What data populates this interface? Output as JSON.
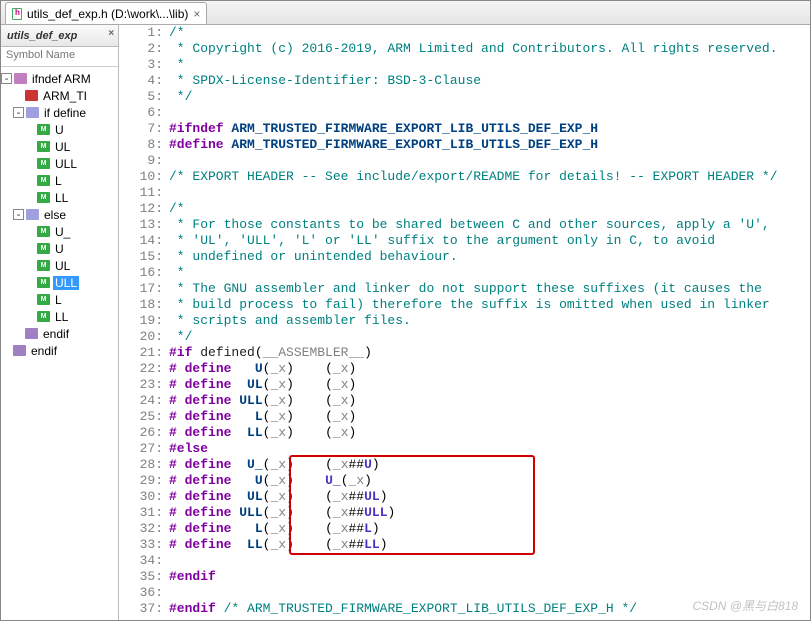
{
  "tab": {
    "title": "utils_def_exp.h (D:\\work\\...\\lib)"
  },
  "side": {
    "panel_title": "utils_def_exp",
    "header": "Symbol Name",
    "nodes": [
      {
        "indent": 0,
        "tw": "-",
        "ic": "ic-ifn",
        "label": "ifndef ARM"
      },
      {
        "indent": 1,
        "tw": "",
        "ic": "ic-red",
        "label": "ARM_TI"
      },
      {
        "indent": 1,
        "tw": "-",
        "ic": "ic-if",
        "label": "if define"
      },
      {
        "indent": 2,
        "tw": "",
        "ic": "ic-m",
        "label": "U"
      },
      {
        "indent": 2,
        "tw": "",
        "ic": "ic-m",
        "label": "UL"
      },
      {
        "indent": 2,
        "tw": "",
        "ic": "ic-m",
        "label": "ULL"
      },
      {
        "indent": 2,
        "tw": "",
        "ic": "ic-m",
        "label": "L"
      },
      {
        "indent": 2,
        "tw": "",
        "ic": "ic-m",
        "label": "LL"
      },
      {
        "indent": 1,
        "tw": "-",
        "ic": "ic-el",
        "label": "else"
      },
      {
        "indent": 2,
        "tw": "",
        "ic": "ic-m",
        "label": "U_"
      },
      {
        "indent": 2,
        "tw": "",
        "ic": "ic-m",
        "label": "U"
      },
      {
        "indent": 2,
        "tw": "",
        "ic": "ic-m",
        "label": "UL"
      },
      {
        "indent": 2,
        "tw": "",
        "ic": "ic-m",
        "label": "ULL",
        "selected": true
      },
      {
        "indent": 2,
        "tw": "",
        "ic": "ic-m",
        "label": "L"
      },
      {
        "indent": 2,
        "tw": "",
        "ic": "ic-m",
        "label": "LL"
      },
      {
        "indent": 1,
        "tw": "",
        "ic": "ic-end",
        "label": "endif"
      },
      {
        "indent": 0,
        "tw": "",
        "ic": "ic-end",
        "label": "endif"
      }
    ]
  },
  "code": {
    "lines": [
      {
        "n": 1,
        "seg": [
          {
            "c": "c-cmt",
            "t": "/*"
          }
        ]
      },
      {
        "n": 2,
        "seg": [
          {
            "c": "c-cmt",
            "t": " * Copyright (c) 2016-2019, ARM Limited and Contributors. All rights reserved."
          }
        ]
      },
      {
        "n": 3,
        "seg": [
          {
            "c": "c-cmt",
            "t": " *"
          }
        ]
      },
      {
        "n": 4,
        "seg": [
          {
            "c": "c-cmt",
            "t": " * SPDX-License-Identifier: BSD-3-Clause"
          }
        ]
      },
      {
        "n": 5,
        "seg": [
          {
            "c": "c-cmt",
            "t": " */"
          }
        ]
      },
      {
        "n": 6,
        "seg": [
          {
            "c": "",
            "t": ""
          }
        ]
      },
      {
        "n": 7,
        "seg": [
          {
            "c": "c-pp",
            "t": "#ifndef"
          },
          {
            "c": "",
            "t": " "
          },
          {
            "c": "c-mac",
            "t": "ARM_TRUSTED_FIRMWARE_EXPORT_LIB_UTILS_DEF_EXP_H"
          }
        ],
        "gut": ":"
      },
      {
        "n": 8,
        "seg": [
          {
            "c": "c-pp",
            "t": "#define"
          },
          {
            "c": "",
            "t": " "
          },
          {
            "c": "c-mac",
            "t": "ARM_TRUSTED_FIRMWARE_EXPORT_LIB_UTILS_DEF_EXP_H"
          }
        ]
      },
      {
        "n": 9,
        "seg": [
          {
            "c": "",
            "t": ""
          }
        ]
      },
      {
        "n": 10,
        "seg": [
          {
            "c": "c-cmt",
            "t": "/* EXPORT HEADER -- See include/export/README for details! -- EXPORT HEADER */"
          }
        ]
      },
      {
        "n": 11,
        "seg": [
          {
            "c": "",
            "t": ""
          }
        ]
      },
      {
        "n": 12,
        "seg": [
          {
            "c": "c-cmt",
            "t": "/*"
          }
        ]
      },
      {
        "n": 13,
        "seg": [
          {
            "c": "c-cmt",
            "t": " * For those constants to be shared between C and other sources, apply a 'U',"
          }
        ]
      },
      {
        "n": 14,
        "seg": [
          {
            "c": "c-cmt",
            "t": " * 'UL', 'ULL', 'L' or 'LL' suffix to the argument only in C, to avoid"
          }
        ]
      },
      {
        "n": 15,
        "seg": [
          {
            "c": "c-cmt",
            "t": " * undefined or unintended behaviour."
          }
        ]
      },
      {
        "n": 16,
        "seg": [
          {
            "c": "c-cmt",
            "t": " *"
          }
        ]
      },
      {
        "n": 17,
        "seg": [
          {
            "c": "c-cmt",
            "t": " * The GNU assembler and linker do not support these suffixes (it causes the"
          }
        ]
      },
      {
        "n": 18,
        "seg": [
          {
            "c": "c-cmt",
            "t": " * build process to fail) therefore the suffix is omitted when used in linker"
          }
        ]
      },
      {
        "n": 19,
        "seg": [
          {
            "c": "c-cmt",
            "t": " * scripts and assembler files."
          }
        ]
      },
      {
        "n": 20,
        "seg": [
          {
            "c": "c-cmt",
            "t": " */"
          }
        ]
      },
      {
        "n": 21,
        "seg": [
          {
            "c": "c-pp",
            "t": "#if"
          },
          {
            "c": "",
            "t": " "
          },
          {
            "c": "c-kw",
            "t": "defined"
          },
          {
            "c": "",
            "t": "("
          },
          {
            "c": "c-arg",
            "t": "__ASSEMBLER__"
          },
          {
            "c": "",
            "t": ")"
          }
        ],
        "gut": ":"
      },
      {
        "n": 22,
        "seg": [
          {
            "c": "c-pp",
            "t": "#"
          },
          {
            "c": "",
            "t": " "
          },
          {
            "c": "c-pp",
            "t": "define"
          },
          {
            "c": "",
            "t": "   "
          },
          {
            "c": "c-mac",
            "t": "U"
          },
          {
            "c": "",
            "t": "("
          },
          {
            "c": "c-arg",
            "t": "_x"
          },
          {
            "c": "",
            "t": ")    ("
          },
          {
            "c": "c-arg",
            "t": "_x"
          },
          {
            "c": "",
            "t": ")"
          }
        ]
      },
      {
        "n": 23,
        "seg": [
          {
            "c": "c-pp",
            "t": "#"
          },
          {
            "c": "",
            "t": " "
          },
          {
            "c": "c-pp",
            "t": "define"
          },
          {
            "c": "",
            "t": "  "
          },
          {
            "c": "c-mac",
            "t": "UL"
          },
          {
            "c": "",
            "t": "("
          },
          {
            "c": "c-arg",
            "t": "_x"
          },
          {
            "c": "",
            "t": ")    ("
          },
          {
            "c": "c-arg",
            "t": "_x"
          },
          {
            "c": "",
            "t": ")"
          }
        ]
      },
      {
        "n": 24,
        "seg": [
          {
            "c": "c-pp",
            "t": "#"
          },
          {
            "c": "",
            "t": " "
          },
          {
            "c": "c-pp",
            "t": "define"
          },
          {
            "c": "",
            "t": " "
          },
          {
            "c": "c-mac",
            "t": "ULL"
          },
          {
            "c": "",
            "t": "("
          },
          {
            "c": "c-arg",
            "t": "_x"
          },
          {
            "c": "",
            "t": ")    ("
          },
          {
            "c": "c-arg",
            "t": "_x"
          },
          {
            "c": "",
            "t": ")"
          }
        ]
      },
      {
        "n": 25,
        "seg": [
          {
            "c": "c-pp",
            "t": "#"
          },
          {
            "c": "",
            "t": " "
          },
          {
            "c": "c-pp",
            "t": "define"
          },
          {
            "c": "",
            "t": "   "
          },
          {
            "c": "c-mac",
            "t": "L"
          },
          {
            "c": "",
            "t": "("
          },
          {
            "c": "c-arg",
            "t": "_x"
          },
          {
            "c": "",
            "t": ")    ("
          },
          {
            "c": "c-arg",
            "t": "_x"
          },
          {
            "c": "",
            "t": ")"
          }
        ]
      },
      {
        "n": 26,
        "seg": [
          {
            "c": "c-pp",
            "t": "#"
          },
          {
            "c": "",
            "t": " "
          },
          {
            "c": "c-pp",
            "t": "define"
          },
          {
            "c": "",
            "t": "  "
          },
          {
            "c": "c-mac",
            "t": "LL"
          },
          {
            "c": "",
            "t": "("
          },
          {
            "c": "c-arg",
            "t": "_x"
          },
          {
            "c": "",
            "t": ")    ("
          },
          {
            "c": "c-arg",
            "t": "_x"
          },
          {
            "c": "",
            "t": ")"
          }
        ]
      },
      {
        "n": 27,
        "seg": [
          {
            "c": "c-pp",
            "t": "#else"
          }
        ],
        "gut": ":"
      },
      {
        "n": 28,
        "seg": [
          {
            "c": "c-pp",
            "t": "#"
          },
          {
            "c": "",
            "t": " "
          },
          {
            "c": "c-pp",
            "t": "define"
          },
          {
            "c": "",
            "t": "  "
          },
          {
            "c": "c-mac",
            "t": "U_"
          },
          {
            "c": "",
            "t": "("
          },
          {
            "c": "c-arg",
            "t": "_x"
          },
          {
            "c": "",
            "t": ")    ("
          },
          {
            "c": "c-arg",
            "t": "_x"
          },
          {
            "c": "",
            "t": "##"
          },
          {
            "c": "c-id",
            "t": "U"
          },
          {
            "c": "",
            "t": ")"
          }
        ],
        "gut": ":"
      },
      {
        "n": 29,
        "seg": [
          {
            "c": "c-pp",
            "t": "#"
          },
          {
            "c": "",
            "t": " "
          },
          {
            "c": "c-pp",
            "t": "define"
          },
          {
            "c": "",
            "t": "   "
          },
          {
            "c": "c-mac",
            "t": "U"
          },
          {
            "c": "",
            "t": "("
          },
          {
            "c": "c-arg",
            "t": "_x"
          },
          {
            "c": "",
            "t": ")    "
          },
          {
            "c": "c-id",
            "t": "U_"
          },
          {
            "c": "",
            "t": "("
          },
          {
            "c": "c-arg",
            "t": "_x"
          },
          {
            "c": "",
            "t": ")"
          }
        ],
        "gut": ":"
      },
      {
        "n": 30,
        "seg": [
          {
            "c": "c-pp",
            "t": "#"
          },
          {
            "c": "",
            "t": " "
          },
          {
            "c": "c-pp",
            "t": "define"
          },
          {
            "c": "",
            "t": "  "
          },
          {
            "c": "c-mac",
            "t": "UL"
          },
          {
            "c": "",
            "t": "("
          },
          {
            "c": "c-arg",
            "t": "_x"
          },
          {
            "c": "",
            "t": ")    ("
          },
          {
            "c": "c-arg",
            "t": "_x"
          },
          {
            "c": "",
            "t": "##"
          },
          {
            "c": "c-id",
            "t": "UL"
          },
          {
            "c": "",
            "t": ")"
          }
        ],
        "gut": ":"
      },
      {
        "n": 31,
        "seg": [
          {
            "c": "c-pp",
            "t": "#"
          },
          {
            "c": "",
            "t": " "
          },
          {
            "c": "c-pp",
            "t": "define"
          },
          {
            "c": "",
            "t": " "
          },
          {
            "c": "c-mac",
            "t": "ULL"
          },
          {
            "c": "",
            "t": "("
          },
          {
            "c": "c-arg",
            "t": "_x"
          },
          {
            "c": "",
            "t": ")    ("
          },
          {
            "c": "c-arg",
            "t": "_x"
          },
          {
            "c": "",
            "t": "##"
          },
          {
            "c": "c-id",
            "t": "ULL"
          },
          {
            "c": "",
            "t": ")"
          }
        ],
        "gut": ":"
      },
      {
        "n": 32,
        "seg": [
          {
            "c": "c-pp",
            "t": "#"
          },
          {
            "c": "",
            "t": " "
          },
          {
            "c": "c-pp",
            "t": "define"
          },
          {
            "c": "",
            "t": "   "
          },
          {
            "c": "c-mac",
            "t": "L"
          },
          {
            "c": "",
            "t": "("
          },
          {
            "c": "c-arg",
            "t": "_x"
          },
          {
            "c": "",
            "t": ")    ("
          },
          {
            "c": "c-arg",
            "t": "_x"
          },
          {
            "c": "",
            "t": "##"
          },
          {
            "c": "c-id",
            "t": "L"
          },
          {
            "c": "",
            "t": ")"
          }
        ],
        "gut": ":"
      },
      {
        "n": 33,
        "seg": [
          {
            "c": "c-pp",
            "t": "#"
          },
          {
            "c": "",
            "t": " "
          },
          {
            "c": "c-pp",
            "t": "define"
          },
          {
            "c": "",
            "t": "  "
          },
          {
            "c": "c-mac",
            "t": "LL"
          },
          {
            "c": "",
            "t": "("
          },
          {
            "c": "c-arg",
            "t": "_x"
          },
          {
            "c": "",
            "t": ")    ("
          },
          {
            "c": "c-arg",
            "t": "_x"
          },
          {
            "c": "",
            "t": "##"
          },
          {
            "c": "c-id",
            "t": "LL"
          },
          {
            "c": "",
            "t": ")"
          }
        ],
        "gut": ":"
      },
      {
        "n": 34,
        "seg": [
          {
            "c": "",
            "t": ""
          }
        ]
      },
      {
        "n": 35,
        "seg": [
          {
            "c": "c-pp",
            "t": "#endif"
          }
        ]
      },
      {
        "n": 36,
        "seg": [
          {
            "c": "",
            "t": ""
          }
        ]
      },
      {
        "n": 37,
        "seg": [
          {
            "c": "c-pp",
            "t": "#endif"
          },
          {
            "c": "",
            "t": " "
          },
          {
            "c": "c-cmt",
            "t": "/* ARM_TRUSTED_FIRMWARE_EXPORT_LIB_UTILS_DEF_EXP_H */"
          }
        ]
      }
    ]
  },
  "watermark": "CSDN @黑与白818"
}
